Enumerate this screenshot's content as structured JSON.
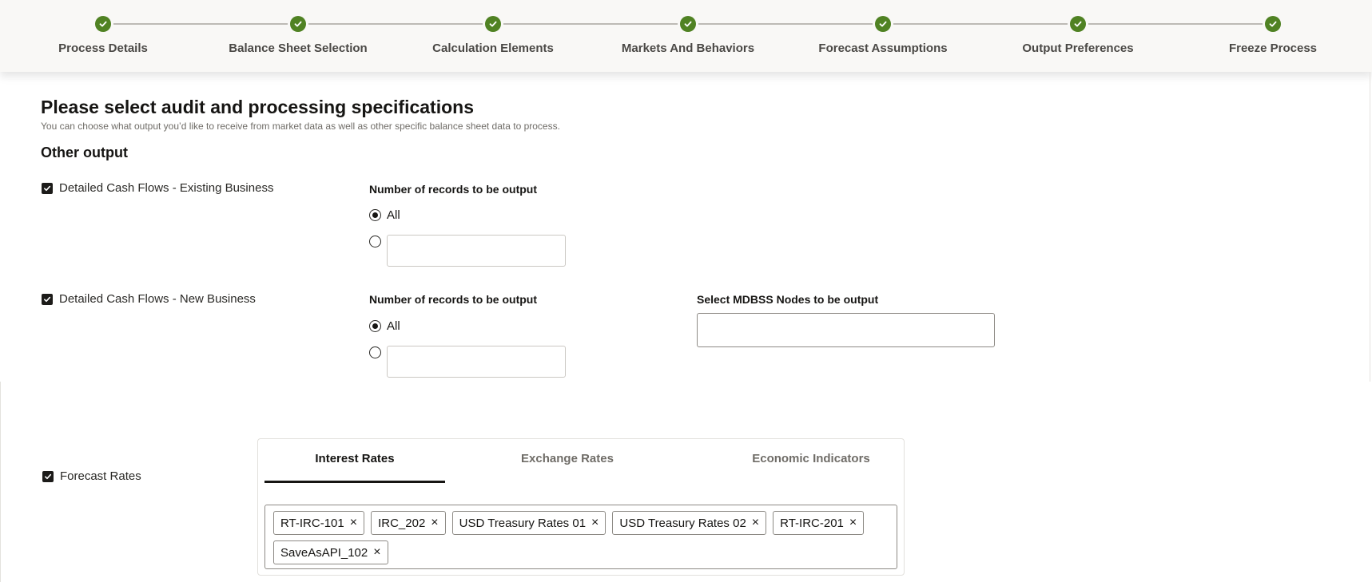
{
  "stepper": {
    "steps": [
      {
        "label": "Process Details",
        "status": "complete"
      },
      {
        "label": "Balance Sheet Selection",
        "status": "complete"
      },
      {
        "label": "Calculation Elements",
        "status": "complete"
      },
      {
        "label": "Markets And Behaviors",
        "status": "complete"
      },
      {
        "label": "Forecast Assumptions",
        "status": "complete"
      },
      {
        "label": "Output Preferences",
        "status": "complete"
      },
      {
        "label": "Freeze Process",
        "status": "complete"
      }
    ],
    "complete_color": "#508223"
  },
  "page": {
    "title": "Please select audit and processing specifications",
    "subtitle": "You can choose what output you’d like to receive from market data as well as other specific balance sheet data to process.",
    "section_title": "Other output"
  },
  "existing_business": {
    "checkbox_label": "Detailed Cash Flows - Existing Business",
    "checked": true,
    "records_label": "Number of records to be output",
    "option_all": "All",
    "selected": "All",
    "custom_value": ""
  },
  "new_business": {
    "checkbox_label": "Detailed Cash Flows - New Business",
    "checked": true,
    "records_label": "Number of records to be output",
    "option_all": "All",
    "selected": "All",
    "custom_value": "",
    "nodes_label": "Select MDBSS Nodes to be output",
    "nodes_value": ""
  },
  "forecast_rates": {
    "checkbox_label": "Forecast Rates",
    "checked": true,
    "tabs": [
      "Interest Rates",
      "Exchange Rates",
      "Economic Indicators"
    ],
    "active_tab": "Interest Rates",
    "chips": [
      "RT-IRC-101",
      "IRC_202",
      "USD Treasury Rates 01",
      "USD Treasury Rates 02",
      "RT-IRC-201",
      "SaveAsAPI_102"
    ],
    "chip_remove_glyph": "×"
  },
  "icons": {
    "step": "check-circle-icon",
    "checkbox": "checkmark-icon",
    "chip_remove": "close-icon"
  }
}
